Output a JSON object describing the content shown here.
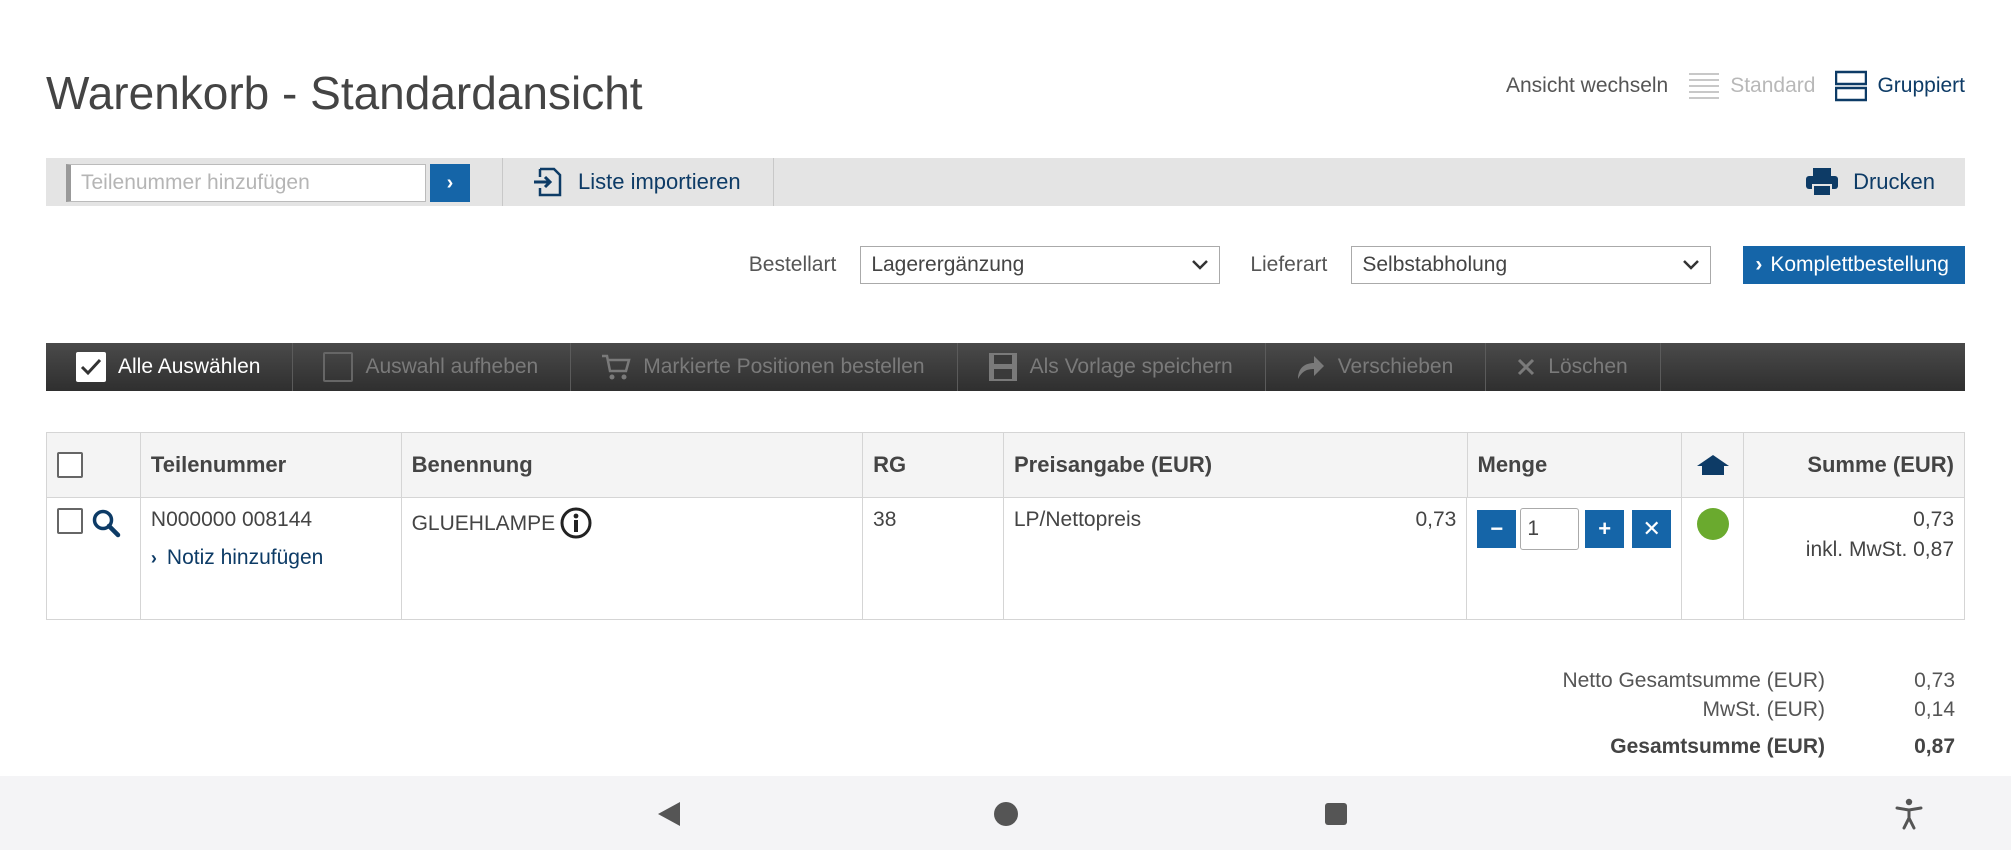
{
  "title": "Warenkorb - Standardansicht",
  "view_switch": {
    "label": "Ansicht wechseln",
    "standard": "Standard",
    "grouped": "Gruppiert",
    "active": "Gruppiert"
  },
  "toolbar": {
    "search_placeholder": "Teilenummer hinzufügen",
    "import_label": "Liste importieren",
    "print_label": "Drucken"
  },
  "order": {
    "bestellart_label": "Bestellart",
    "bestellart_value": "Lagerergänzung",
    "lieferart_label": "Lieferart",
    "lieferart_value": "Selbstabholung",
    "submit_label": "Komplettbestellung"
  },
  "actions": {
    "select_all": "Alle Auswählen",
    "deselect": "Auswahl aufheben",
    "order_marked": "Markierte Positionen bestellen",
    "save_template": "Als Vorlage speichern",
    "move": "Verschieben",
    "delete": "Löschen"
  },
  "table": {
    "headers": {
      "part_no": "Teilenummer",
      "name": "Benennung",
      "rg": "RG",
      "price": "Preisangabe (EUR)",
      "qty": "Menge",
      "sum": "Summe (EUR)"
    },
    "rows": [
      {
        "part_no": "N000000 008144",
        "note_link": "Notiz hinzufügen",
        "name": "GLUEHLAMPE",
        "rg": "38",
        "price_type": "LP/Nettopreis",
        "price": "0,73",
        "qty": "1",
        "availability": "available",
        "sum": "0,73",
        "sum_vat": "inkl. MwSt. 0,87"
      }
    ]
  },
  "totals": {
    "net_label": "Netto Gesamtsumme (EUR)",
    "net_value": "0,73",
    "vat_label": "MwSt. (EUR)",
    "vat_value": "0,14",
    "gross_label": "Gesamtsumme (EUR)",
    "gross_value": "0,87"
  },
  "colors": {
    "accent": "#1565a8",
    "link": "#0d3b66",
    "available": "#6aaa2e",
    "toolbar_dark": "#3a3a3a"
  }
}
